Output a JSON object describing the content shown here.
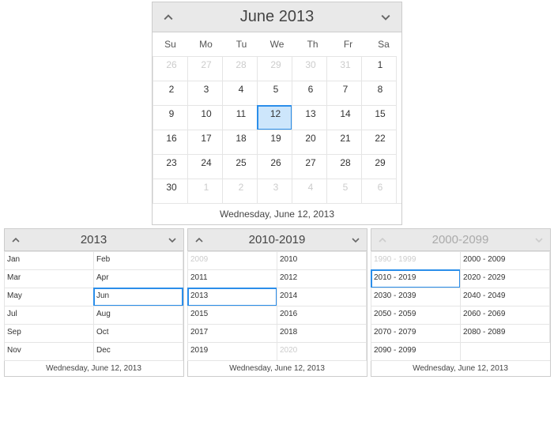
{
  "main": {
    "title": "June 2013",
    "dow": [
      "Su",
      "Mo",
      "Tu",
      "We",
      "Th",
      "Fr",
      "Sa"
    ],
    "weeks": [
      [
        {
          "d": "26",
          "other": true
        },
        {
          "d": "27",
          "other": true
        },
        {
          "d": "28",
          "other": true
        },
        {
          "d": "29",
          "other": true
        },
        {
          "d": "30",
          "other": true
        },
        {
          "d": "31",
          "other": true
        },
        {
          "d": "1"
        }
      ],
      [
        {
          "d": "2"
        },
        {
          "d": "3"
        },
        {
          "d": "4"
        },
        {
          "d": "5"
        },
        {
          "d": "6"
        },
        {
          "d": "7"
        },
        {
          "d": "8"
        }
      ],
      [
        {
          "d": "9"
        },
        {
          "d": "10"
        },
        {
          "d": "11"
        },
        {
          "d": "12",
          "selected": true
        },
        {
          "d": "13"
        },
        {
          "d": "14"
        },
        {
          "d": "15"
        }
      ],
      [
        {
          "d": "16"
        },
        {
          "d": "17"
        },
        {
          "d": "18"
        },
        {
          "d": "19"
        },
        {
          "d": "20"
        },
        {
          "d": "21"
        },
        {
          "d": "22"
        }
      ],
      [
        {
          "d": "23"
        },
        {
          "d": "24"
        },
        {
          "d": "25"
        },
        {
          "d": "26"
        },
        {
          "d": "27"
        },
        {
          "d": "28"
        },
        {
          "d": "29"
        }
      ],
      [
        {
          "d": "30"
        },
        {
          "d": "1",
          "other": true
        },
        {
          "d": "2",
          "other": true
        },
        {
          "d": "3",
          "other": true
        },
        {
          "d": "4",
          "other": true
        },
        {
          "d": "5",
          "other": true
        },
        {
          "d": "6",
          "other": true
        }
      ]
    ],
    "footer": "Wednesday, June 12, 2013"
  },
  "months": {
    "title": "2013",
    "rows": [
      [
        {
          "t": "Jan"
        },
        {
          "t": "Feb"
        }
      ],
      [
        {
          "t": "Mar"
        },
        {
          "t": "Apr"
        }
      ],
      [
        {
          "t": "May"
        },
        {
          "t": "Jun",
          "selected": true
        }
      ],
      [
        {
          "t": "Jul"
        },
        {
          "t": "Aug"
        }
      ],
      [
        {
          "t": "Sep"
        },
        {
          "t": "Oct"
        }
      ],
      [
        {
          "t": "Nov"
        },
        {
          "t": "Dec"
        }
      ]
    ],
    "footer": "Wednesday, June 12, 2013"
  },
  "years": {
    "title": "2010-2019",
    "rows": [
      [
        {
          "t": "2009",
          "other": true
        },
        {
          "t": "2010"
        }
      ],
      [
        {
          "t": "2011"
        },
        {
          "t": "2012"
        }
      ],
      [
        {
          "t": "2013",
          "selected": true
        },
        {
          "t": "2014"
        }
      ],
      [
        {
          "t": "2015"
        },
        {
          "t": "2016"
        }
      ],
      [
        {
          "t": "2017"
        },
        {
          "t": "2018"
        }
      ],
      [
        {
          "t": "2019"
        },
        {
          "t": "2020",
          "other": true
        }
      ]
    ],
    "footer": "Wednesday, June 12, 2013"
  },
  "decades": {
    "title": "2000-2099",
    "rows": [
      [
        {
          "t": "1990 - 1999",
          "other": true
        },
        {
          "t": "2000 - 2009"
        }
      ],
      [
        {
          "t": "2010 - 2019",
          "selected": true
        },
        {
          "t": "2020 - 2029"
        }
      ],
      [
        {
          "t": "2030 - 2039"
        },
        {
          "t": "2040 - 2049"
        }
      ],
      [
        {
          "t": "2050 - 2059"
        },
        {
          "t": "2060 - 2069"
        }
      ],
      [
        {
          "t": "2070 - 2079"
        },
        {
          "t": "2080 - 2089"
        }
      ],
      [
        {
          "t": "2090 - 2099"
        }
      ]
    ],
    "footer": "Wednesday, June 12, 2013"
  }
}
